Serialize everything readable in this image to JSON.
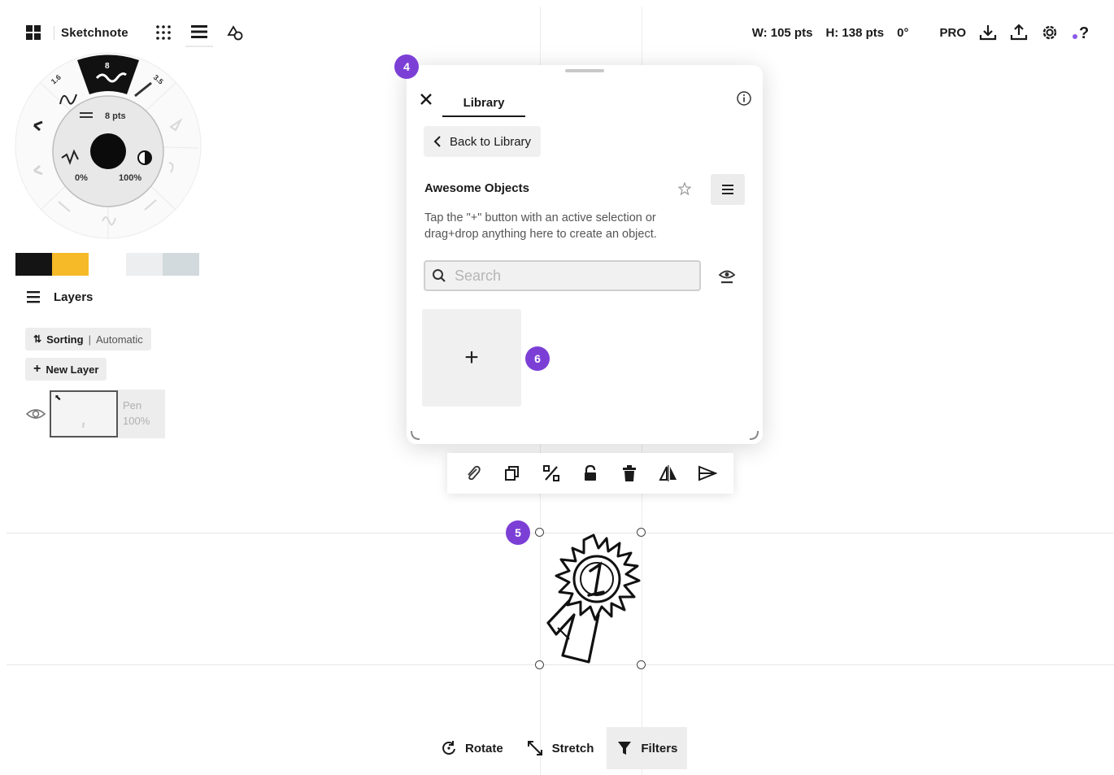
{
  "app": {
    "title": "Sketchnote"
  },
  "topbar_right": {
    "width": "W: 105 pts",
    "height": "H: 138 pts",
    "rotation": "0°",
    "pro": "PRO"
  },
  "brush_wheel": {
    "size_label": "8 pts",
    "opacity_min": "0%",
    "opacity_max": "100%",
    "slot_top": "8",
    "slot_left": "1.6",
    "slot_right": "3.5"
  },
  "colors": {
    "swatch_1": "#141414",
    "swatch_2": "#f6b928",
    "swatch_3": "#eceeef",
    "swatch_4": "#d2dadd",
    "accent": "#7c3fd6"
  },
  "layers": {
    "title": "Layers",
    "sorting_label": "Sorting",
    "sorting_value": "Automatic",
    "new_layer": "New Layer",
    "layer_name": "Pen",
    "layer_opacity": "100%"
  },
  "library": {
    "tab": "Library",
    "back_label": "Back to Library",
    "collection_title": "Awesome Objects",
    "description": "Tap the \"+\" button with an active selection or drag+drop anything here to create an object.",
    "search_placeholder": "Search",
    "add_tile": "+"
  },
  "badges": {
    "panel": "4",
    "selection": "5",
    "add": "6"
  },
  "bottom_bar": {
    "rotate": "Rotate",
    "stretch": "Stretch",
    "filters": "Filters"
  },
  "icons": [
    "grid-icon",
    "dots-grid-icon",
    "menu-icon",
    "shapes-icon",
    "download-icon",
    "upload-icon",
    "gear-icon",
    "help-icon",
    "close-icon",
    "info-icon",
    "chevron-left-icon",
    "star-icon",
    "list-icon",
    "search-icon",
    "eye-icon",
    "paperclip-icon",
    "duplicate-icon",
    "percent-icon",
    "lock-icon",
    "trash-icon",
    "flip-icon",
    "send-icon",
    "rotate-icon",
    "stretch-icon",
    "filter-icon"
  ]
}
